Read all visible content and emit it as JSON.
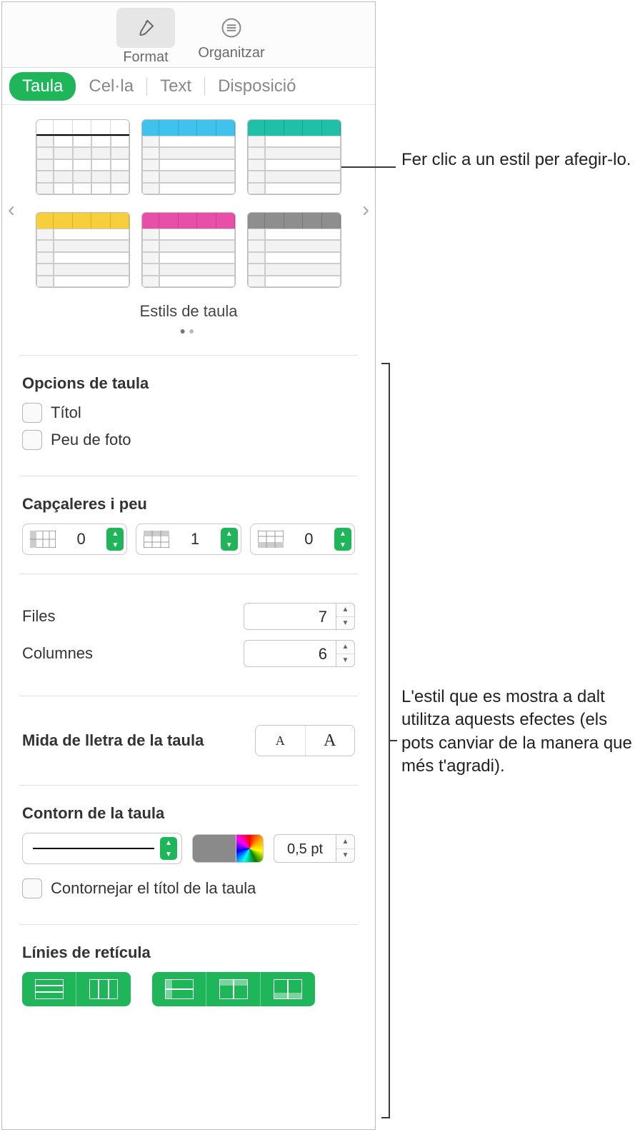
{
  "toolbar": {
    "format_label": "Format",
    "organize_label": "Organitzar"
  },
  "tabs": {
    "table": "Taula",
    "cell": "Cel·la",
    "text": "Text",
    "layout": "Disposició"
  },
  "styles": {
    "caption": "Estils de taula",
    "colors": [
      "black",
      "cyan",
      "green",
      "yellow",
      "magenta",
      "gray"
    ]
  },
  "options": {
    "title": "Opcions de taula",
    "title_label": "Títol",
    "caption_label": "Peu de foto"
  },
  "headers": {
    "title": "Capçaleres i peu",
    "header_cols": "0",
    "header_rows": "1",
    "footer_rows": "0"
  },
  "size": {
    "rows_label": "Files",
    "rows_value": "7",
    "cols_label": "Columnes",
    "cols_value": "6"
  },
  "font": {
    "label": "Mida de lletra de la taula",
    "small": "A",
    "large": "A"
  },
  "outline": {
    "title": "Contorn de la taula",
    "width": "0,5 pt",
    "outline_title_label": "Contornejar el títol de la taula"
  },
  "gridlines": {
    "title": "Línies de retícula"
  },
  "annotations": {
    "style_click": "Fer clic a un estil per afegir-lo.",
    "effects": "L'estil que es mostra a dalt utilitza aquests efectes (els pots canviar de la manera que més t'agradi)."
  }
}
